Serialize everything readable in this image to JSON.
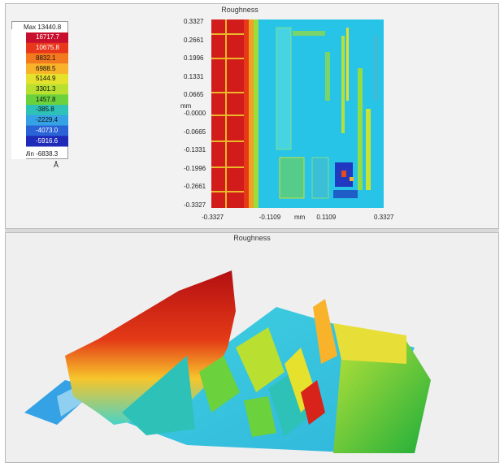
{
  "top_panel": {
    "title": "Roughness",
    "legend": {
      "max_label": "Max 13440.8",
      "min_label": "Min -6838.3",
      "unit": "Å",
      "values": [
        "16717.7",
        "10675.8",
        "8832.1",
        "6988.5",
        "5144.9",
        "3301.3",
        "1457.8",
        "-385.8",
        "-2229.4",
        "-4073.0",
        "-5916.6"
      ],
      "colors": [
        "#c8102e",
        "#e8371b",
        "#f47a1f",
        "#f9b32a",
        "#e5e12c",
        "#b9e030",
        "#6bd13c",
        "#2ec1b8",
        "#35a2e6",
        "#2a63d6",
        "#1f2bb8"
      ]
    },
    "map": {
      "y_unit": "mm",
      "x_unit": "mm",
      "y_ticks": [
        "0.3327",
        "0.2661",
        "0.1996",
        "0.1331",
        "0.0665",
        "-0.0000",
        "-0.0665",
        "-0.1331",
        "-0.1996",
        "-0.2661",
        "-0.3327"
      ],
      "x_ticks": [
        "-0.3327",
        "-0.1109",
        "0.1109",
        "0.3327"
      ]
    }
  },
  "bottom_panel": {
    "title": "Roughness"
  }
}
